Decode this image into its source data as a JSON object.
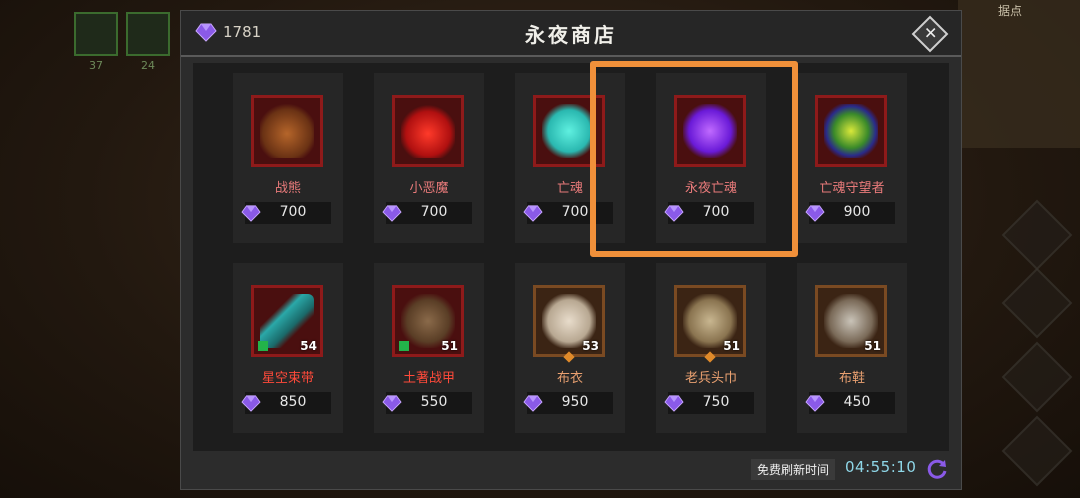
{
  "background": {
    "slots": [
      {
        "count": "37"
      },
      {
        "count": "24"
      }
    ],
    "minimap_label": "据点"
  },
  "shop": {
    "title": "永夜商店",
    "currency_amount": "1781",
    "refresh_label": "免费刷新时间",
    "refresh_timer": "04:55:10",
    "highlighted_item": "永夜亡魂"
  },
  "items": [
    {
      "name": "战熊",
      "price": "700",
      "kind": "hero",
      "icon": "werebear-portrait"
    },
    {
      "name": "小恶魔",
      "price": "700",
      "kind": "hero",
      "icon": "imp-portrait"
    },
    {
      "name": "亡魂",
      "price": "700",
      "kind": "hero",
      "icon": "ghost-portrait"
    },
    {
      "name": "永夜亡魂",
      "price": "700",
      "kind": "hero",
      "icon": "night-ghost-portrait"
    },
    {
      "name": "亡魂守望者",
      "price": "900",
      "kind": "hero",
      "icon": "ghost-warden-portrait"
    },
    {
      "name": "星空束带",
      "price": "850",
      "kind": "equipment",
      "level": "54",
      "icon": "belt-icon"
    },
    {
      "name": "土著战甲",
      "price": "550",
      "kind": "equipment",
      "level": "51",
      "icon": "armor-icon"
    },
    {
      "name": "布衣",
      "price": "950",
      "kind": "equipment",
      "level": "53",
      "icon": "cloth-shirt-icon"
    },
    {
      "name": "老兵头巾",
      "price": "750",
      "kind": "equipment",
      "level": "51",
      "icon": "bandana-icon"
    },
    {
      "name": "布鞋",
      "price": "450",
      "kind": "equipment",
      "level": "51",
      "icon": "cloth-boots-icon"
    }
  ],
  "colors": {
    "accent_highlight": "#f0903a",
    "currency_gem": "#8a5ae8",
    "timer": "#8fd7e8"
  }
}
